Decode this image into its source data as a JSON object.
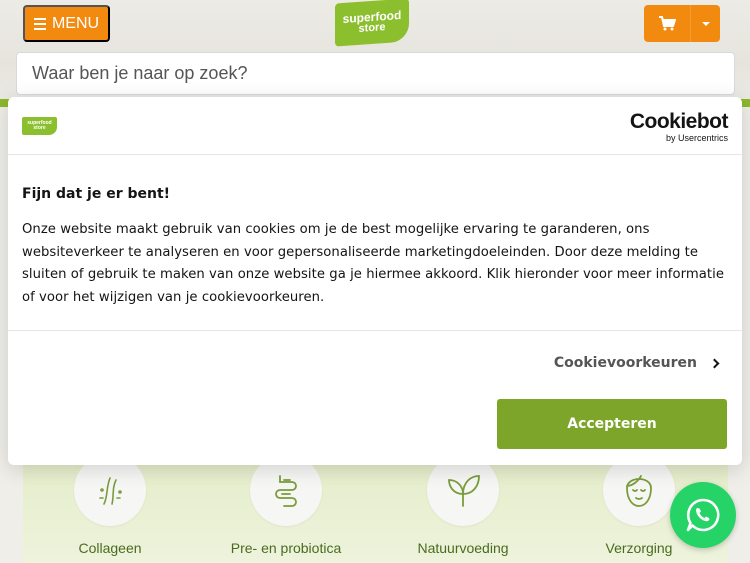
{
  "header": {
    "menu_label": "MENU",
    "logo_line1": "superfood",
    "logo_line2": "store",
    "search_placeholder": "Waar ben je naar op zoek?"
  },
  "categories": [
    {
      "label": "Collageen",
      "icon": "collagen-icon"
    },
    {
      "label": "Pre- en probiotica",
      "icon": "intestine-icon"
    },
    {
      "label": "Natuurvoeding",
      "icon": "leaf-icon"
    },
    {
      "label": "Verzorging",
      "icon": "face-icon"
    }
  ],
  "cookie_dialog": {
    "brand": "Cookiebot",
    "brand_sub": "by Usercentrics",
    "title": "Fijn dat je er bent!",
    "text": "Onze website maakt gebruik van cookies om je de best mogelijke ervaring te garanderen, ons websiteverkeer te analyseren en voor gepersonaliseerde marketingdoeleinden. Door deze melding te sluiten of gebruik te maken van onze website ga je hiermee akkoord. Klik hieronder voor meer informatie of voor het wijzigen van je cookievoorkeuren.",
    "preferences_label": "Cookievoorkeuren",
    "accept_label": "Accepteren"
  },
  "colors": {
    "orange": "#f28a10",
    "brand_green": "#8cbf2e",
    "accept_green": "#7ca52a",
    "whatsapp": "#25d366"
  }
}
